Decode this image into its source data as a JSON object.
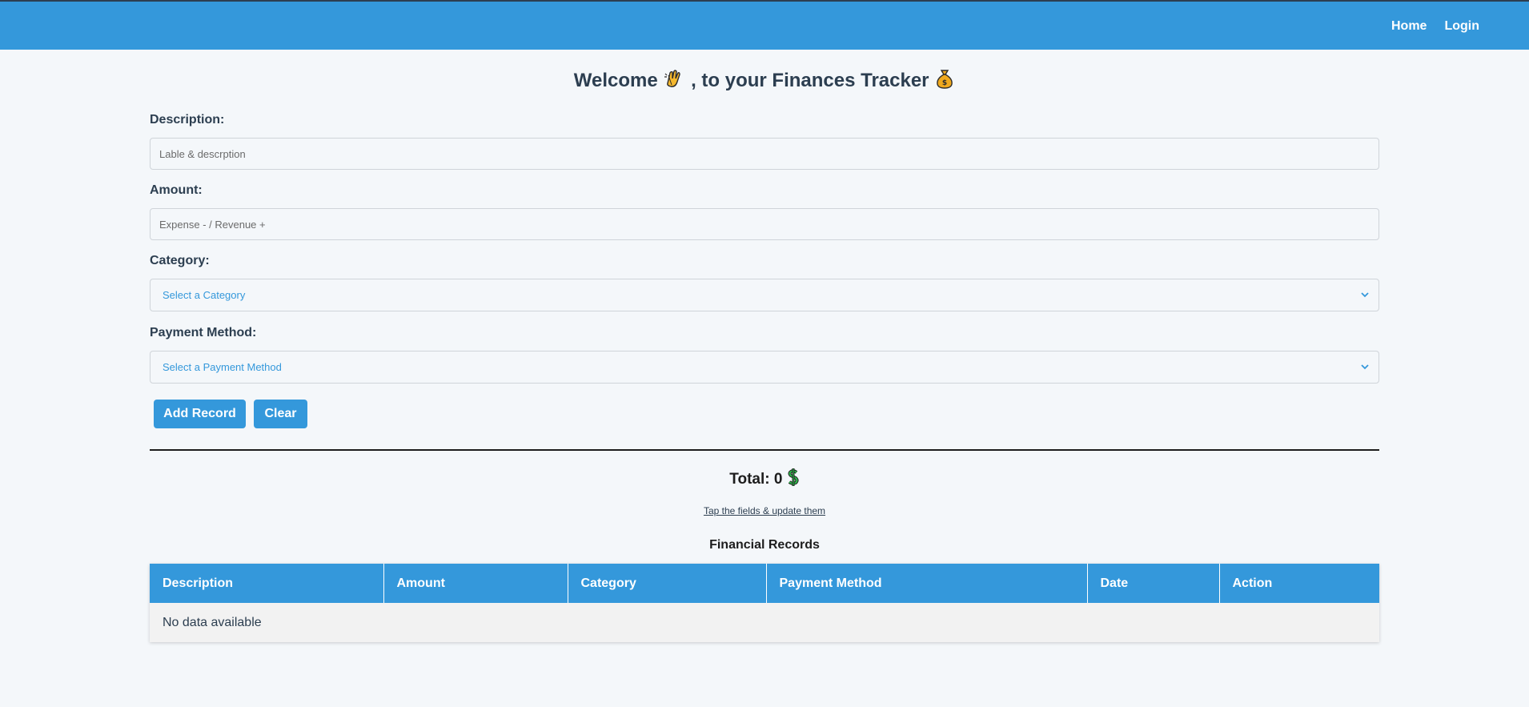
{
  "nav": {
    "home": "Home",
    "login": "Login"
  },
  "header": {
    "title_pre": "Welcome",
    "title_post": ", to your Finances Tracker"
  },
  "form": {
    "description_label": "Description:",
    "description_placeholder": "Lable & descrption",
    "amount_label": "Amount:",
    "amount_placeholder": "Expense - / Revenue +",
    "category_label": "Category:",
    "category_value": "Select a Category",
    "payment_label": "Payment Method:",
    "payment_value": "Select a Payment Method",
    "add_button": "Add Record",
    "clear_button": "Clear"
  },
  "summary": {
    "total_label": "Total: 0"
  },
  "hint": "Tap the fields & update them",
  "records": {
    "title": "Financial Records",
    "columns": [
      "Description",
      "Amount",
      "Category",
      "Payment Method",
      "Date",
      "Action"
    ],
    "empty_text": "No data available"
  },
  "colors": {
    "accent": "#3498db",
    "background": "#f4f7fa",
    "text": "#2c3e50"
  },
  "icons": {
    "wave": "clapping-hands-icon",
    "money": "money-bag-icon",
    "dollar": "dollar-icon",
    "chevron": "chevron-down-icon"
  }
}
